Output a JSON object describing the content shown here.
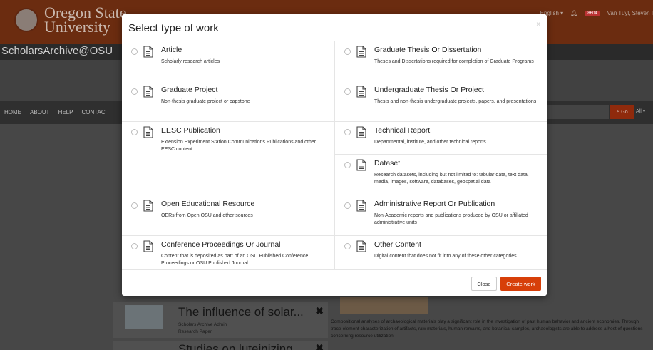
{
  "header": {
    "logo_line1": "Oregon State",
    "logo_line2": "University",
    "language": "English ▾",
    "notification_count": "8604",
    "user": "Van Tuyl, Steven I"
  },
  "site_title": "ScholarsArchive@OSU",
  "nav": [
    "HOME",
    "ABOUT",
    "HELP",
    "CONTAC"
  ],
  "search": {
    "go_label": "Go",
    "all_label": "All ▾"
  },
  "works": [
    {
      "title": "The influence of solar...",
      "owner": "Scholars Archive Admin",
      "type": "Research Paper"
    },
    {
      "title": "Studies on luteinizing..."
    }
  ],
  "background_description": "Compositional analyses of archaeological materials play a significant role in the investigation of past human behavior and ancient economies. Through trace-element characterization of artifacts, raw materials, human remains, and botanical samples, archaeologists are able to address a host of questions concerning resource utilization,",
  "modal": {
    "title": "Select type of work",
    "close_x": "×",
    "options": [
      {
        "title": "Article",
        "desc": "Scholarly research articles"
      },
      {
        "title": "Graduate Thesis Or Dissertation",
        "desc": "Theses and Dissertations required for completion of Graduate Programs"
      },
      {
        "title": "Graduate Project",
        "desc": "Non-thesis graduate project or capstone"
      },
      {
        "title": "Undergraduate Thesis Or Project",
        "desc": "Thesis and non-thesis undergraduate projects, papers, and presentations"
      },
      {
        "title": "EESC Publication",
        "desc": "Extension Experiment Station Communications Publications and other EESC content"
      },
      {
        "title": "Technical Report",
        "desc": "Departmental, institute, and other technical reports"
      },
      {
        "title": "Dataset",
        "desc": "Research datasets, including but not limited to: tabular data, text data, media, images, software, databases, geospatial data"
      },
      {
        "title": "Open Educational Resource",
        "desc": "OERs from Open OSU and other sources"
      },
      {
        "title": "Administrative Report Or Publication",
        "desc": "Non-Academic reports and publications produced by OSU or affiliated administrative units"
      },
      {
        "title": "Conference Proceedings Or Journal",
        "desc": "Content that is deposited as part of an OSU Published Conference Proceedings or OSU Published Journal"
      },
      {
        "title": "Other Content",
        "desc": "Digital content that does not fit into any of these other categories"
      }
    ],
    "close_button": "Close",
    "create_button": "Create work"
  },
  "colors": {
    "brand": "#d73f09",
    "header_bg": "#6b2c10"
  },
  "icons": {
    "option_icon": "document-icon",
    "notification": "bell-icon",
    "search": "search-icon"
  }
}
